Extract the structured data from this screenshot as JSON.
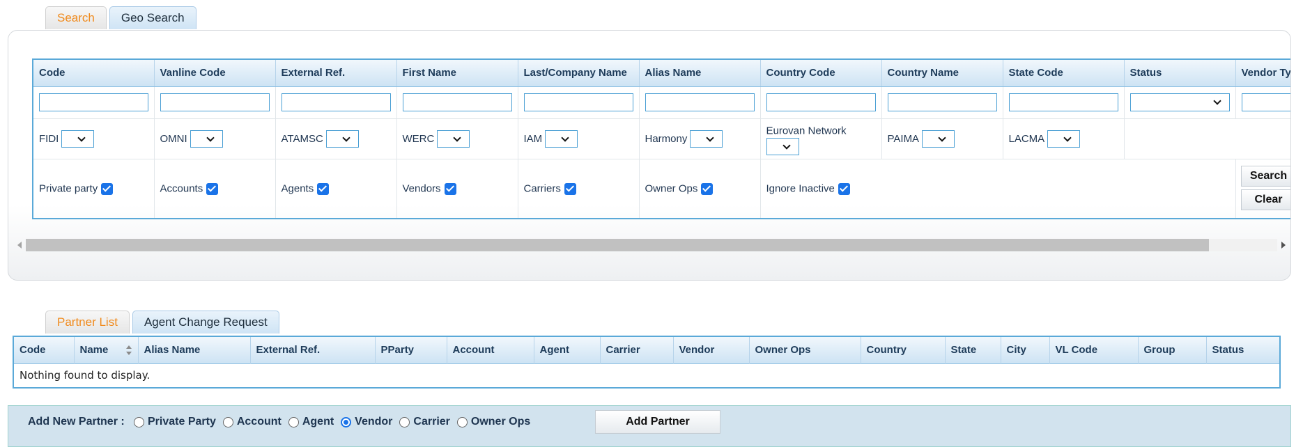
{
  "search_tabs": [
    "Search",
    "Geo Search"
  ],
  "search": {
    "columns": [
      "Code",
      "Vanline Code",
      "External Ref.",
      "First Name",
      "Last/Company Name",
      "Alias Name",
      "Country Code",
      "Country Name",
      "State Code",
      "Status",
      "Vendor Type"
    ],
    "network_filters": [
      "FIDI",
      "OMNI",
      "ATAMSC",
      "WERC",
      "IAM",
      "Harmony",
      "Eurovan Network",
      "PAIMA",
      "LACMA"
    ],
    "type_checks": [
      "Private party",
      "Accounts",
      "Agents",
      "Vendors",
      "Carriers",
      "Owner Ops",
      "Ignore Inactive"
    ],
    "search_button": "Search",
    "clear_button": "Clear"
  },
  "list_tabs": [
    "Partner List",
    "Agent Change Request"
  ],
  "partner_list": {
    "columns": [
      "Code",
      "Name",
      "Alias Name",
      "External Ref.",
      "PParty",
      "Account",
      "Agent",
      "Carrier",
      "Vendor",
      "Owner Ops",
      "Country",
      "State",
      "City",
      "VL Code",
      "Group",
      "Status"
    ],
    "empty_message": "Nothing found to display."
  },
  "add_partner": {
    "title": "Add New Partner :",
    "options": [
      "Private Party",
      "Account",
      "Agent",
      "Vendor",
      "Carrier",
      "Owner Ops"
    ],
    "selected": "Vendor",
    "button": "Add Partner"
  }
}
